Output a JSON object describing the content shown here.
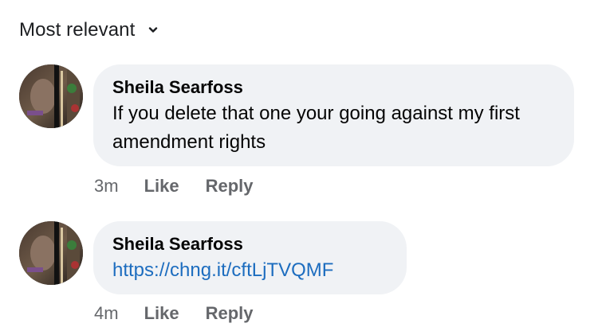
{
  "sort": {
    "label": "Most relevant"
  },
  "comments": [
    {
      "author": "Sheila Searfoss",
      "text": "If you delete that one your going against my first amendment rights",
      "time": "3m",
      "like_label": "Like",
      "reply_label": "Reply"
    },
    {
      "author": "Sheila Searfoss",
      "link": "https://chng.it/cftLjTVQMF",
      "time": "4m",
      "like_label": "Like",
      "reply_label": "Reply"
    }
  ],
  "colors": {
    "bubble": "#f0f2f5",
    "link": "#1d6dbf",
    "meta": "#65676b"
  }
}
